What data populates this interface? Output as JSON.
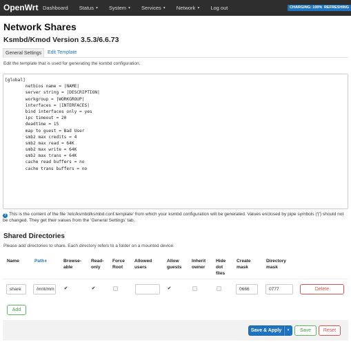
{
  "topbar": {
    "brand": "OpenWrt",
    "menu": [
      {
        "label": "Dashboard",
        "caret": false
      },
      {
        "label": "Status",
        "caret": true
      },
      {
        "label": "System",
        "caret": true
      },
      {
        "label": "Services",
        "caret": true
      },
      {
        "label": "Network",
        "caret": true
      },
      {
        "label": "Log out",
        "caret": false
      }
    ],
    "badges": [
      "CHARGING: 100%",
      "REFRESHING"
    ],
    "caret_glyph": "▾"
  },
  "page": {
    "title": "Network Shares",
    "subtitle": "Ksmbd/Kmod Version 3.5.3/6.6.73",
    "tabs": [
      "General Settings",
      "Edit Template"
    ],
    "active_tab": "Edit Template",
    "description": "Edit the template that is used for generating the ksmbd configuration."
  },
  "template": {
    "lines": [
      "[global]",
      "        netbios name = |NAME|",
      "        server string = |DESCRIPTION|",
      "        workgroup = |WORKGROUP|",
      "        interfaces = |INTERFACES|",
      "        bind interfaces only = yes",
      "        ipc timeout = 20",
      "        deadtime = 15",
      "        map to guest = Bad User",
      "        smb2 max credits = 4",
      "        smb2 max read = 64K",
      "        smb2 max write = 64K",
      "        smb2 max trans = 64K",
      "        cache read buffers = no",
      "        cache trans buffers = no"
    ],
    "help_icon": "?",
    "help": "This is the content of the file '/etc/ksmbd/ksmbd.conf.template' from which your ksmbd configuration will be generated. Values enclosed by pipe symbols ('|') should not be changed. They get their values from the 'General Settings' tab."
  },
  "shares": {
    "title": "Shared Directories",
    "description": "Please add directories to share. Each directory refers to a folder on a mounted device.",
    "columns": {
      "name": "Name",
      "path": "Path",
      "browseable": [
        "Browse-",
        "able"
      ],
      "read_only": [
        "Read-",
        "only"
      ],
      "force_root": [
        "Force",
        "Root"
      ],
      "allowed_users": [
        "Allowed",
        "users"
      ],
      "allow_guests": [
        "Allow",
        "guests"
      ],
      "inherit_owner": [
        "Inherit",
        "owner"
      ],
      "hide_dot_files": [
        "Hide",
        "dot",
        "files"
      ],
      "create_mask": [
        "Create",
        "mask"
      ],
      "directory_mask": [
        "Directory",
        "mask"
      ]
    },
    "sort_icon": "⬍",
    "row": {
      "name": "share",
      "path": "/mnt/mm",
      "browseable": true,
      "read_only": true,
      "force_root": false,
      "allowed_users": "",
      "allow_guests": true,
      "inherit_owner": false,
      "hide_dot_files": false,
      "create_mask": "0666",
      "directory_mask": "0777",
      "check_glyph": "✔",
      "delete_label": "Delete"
    },
    "add_label": "Add"
  },
  "footer": {
    "save_apply": "Save & Apply",
    "save_apply_caret": "▾",
    "save": "Save",
    "reset": "Reset"
  },
  "colors": {
    "topbar": "#2e2e2e",
    "accent": "#1f74c1",
    "danger": "#d9534f",
    "success": "#5cb85c"
  }
}
